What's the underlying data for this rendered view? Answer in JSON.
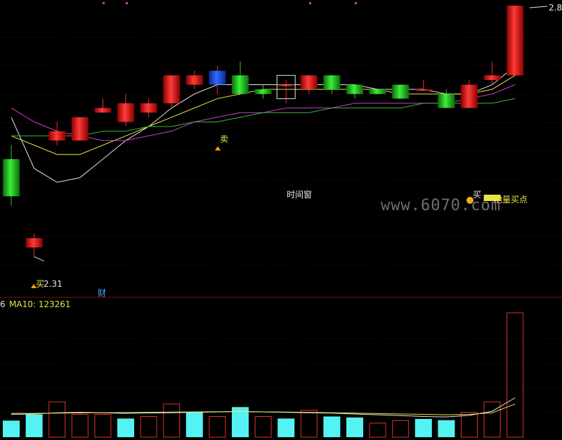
{
  "watermark": "www.6070.com",
  "labels": {
    "sell": "卖",
    "buy_left": "买",
    "low_price": "2.31",
    "high_price": "2.8",
    "cai": "财",
    "time_window": "时间窗",
    "buy_right": "买",
    "bottom_buy": "地量买点",
    "vol_prefix": "6",
    "ma10_label": "MA10: 123261"
  },
  "colors": {
    "up": "#ff2a2a",
    "down": "#22cc22",
    "ma_white": "#e6e6e6",
    "ma_yellow": "#e8e34a",
    "ma_magenta": "#d23ad2",
    "ma_green": "#37b837",
    "vol_up_outline": "#e03030",
    "vol_down_fill": "#54f2f2",
    "sell_candle": "#1a4fd6",
    "grid": "#4a0a0a"
  },
  "chart_data": [
    {
      "type": "candlestick",
      "title": "",
      "ylim": [
        2.25,
        2.85
      ],
      "candles": [
        {
          "o": 2.52,
          "c": 2.44,
          "h": 2.55,
          "l": 2.42
        },
        {
          "o": 2.33,
          "c": 2.35,
          "h": 2.36,
          "l": 2.31
        },
        {
          "o": 2.56,
          "c": 2.58,
          "h": 2.6,
          "l": 2.55
        },
        {
          "o": 2.56,
          "c": 2.61,
          "h": 2.61,
          "l": 2.56
        },
        {
          "o": 2.62,
          "c": 2.63,
          "h": 2.65,
          "l": 2.62
        },
        {
          "o": 2.6,
          "c": 2.64,
          "h": 2.66,
          "l": 2.59
        },
        {
          "o": 2.62,
          "c": 2.64,
          "h": 2.65,
          "l": 2.61
        },
        {
          "o": 2.64,
          "c": 2.7,
          "h": 2.7,
          "l": 2.63
        },
        {
          "o": 2.68,
          "c": 2.7,
          "h": 2.71,
          "l": 2.67
        },
        {
          "o": 2.68,
          "c": 2.71,
          "h": 2.72,
          "l": 2.66
        },
        {
          "o": 2.7,
          "c": 2.66,
          "h": 2.73,
          "l": 2.66
        },
        {
          "o": 2.67,
          "c": 2.66,
          "h": 2.68,
          "l": 2.65
        },
        {
          "o": 2.68,
          "c": 2.68,
          "h": 2.69,
          "l": 2.64
        },
        {
          "o": 2.67,
          "c": 2.7,
          "h": 2.7,
          "l": 2.66
        },
        {
          "o": 2.7,
          "c": 2.67,
          "h": 2.7,
          "l": 2.66
        },
        {
          "o": 2.68,
          "c": 2.66,
          "h": 2.68,
          "l": 2.65
        },
        {
          "o": 2.67,
          "c": 2.66,
          "h": 2.67,
          "l": 2.66
        },
        {
          "o": 2.68,
          "c": 2.65,
          "h": 2.68,
          "l": 2.65
        },
        {
          "o": 2.67,
          "c": 2.67,
          "h": 2.69,
          "l": 2.67
        },
        {
          "o": 2.66,
          "c": 2.63,
          "h": 2.67,
          "l": 2.63
        },
        {
          "o": 2.63,
          "c": 2.68,
          "h": 2.69,
          "l": 2.63
        },
        {
          "o": 2.69,
          "c": 2.7,
          "h": 2.73,
          "l": 2.68
        },
        {
          "o": 2.7,
          "c": 2.85,
          "h": 2.85,
          "l": 2.7
        }
      ],
      "ma_series": [
        {
          "values": [
            2.61,
            2.5,
            2.47,
            2.48,
            2.52,
            2.56,
            2.59,
            2.63,
            2.66,
            2.68,
            2.68,
            2.68,
            2.68,
            2.68,
            2.68,
            2.68,
            2.67,
            2.67,
            2.67,
            2.66,
            2.66,
            2.68,
            2.72
          ]
        },
        {
          "values": [
            2.57,
            2.55,
            2.53,
            2.53,
            2.55,
            2.57,
            2.59,
            2.61,
            2.63,
            2.65,
            2.66,
            2.67,
            2.67,
            2.67,
            2.67,
            2.67,
            2.67,
            2.66,
            2.66,
            2.66,
            2.66,
            2.67,
            2.7
          ]
        },
        {
          "values": [
            2.63,
            2.6,
            2.58,
            2.57,
            2.56,
            2.56,
            2.57,
            2.58,
            2.6,
            2.61,
            2.62,
            2.62,
            2.63,
            2.63,
            2.63,
            2.64,
            2.64,
            2.64,
            2.64,
            2.64,
            2.65,
            2.66,
            2.68
          ]
        },
        {
          "values": [
            2.57,
            2.57,
            2.57,
            2.57,
            2.58,
            2.58,
            2.59,
            2.59,
            2.6,
            2.6,
            2.61,
            2.62,
            2.62,
            2.62,
            2.63,
            2.63,
            2.63,
            2.63,
            2.64,
            2.64,
            2.64,
            2.64,
            2.65
          ]
        }
      ]
    },
    {
      "type": "bar",
      "title": "",
      "ylim": [
        0,
        600000
      ],
      "series": [
        {
          "values": [
            80000,
            110000,
            170000,
            110000,
            110000,
            90000,
            100000,
            160000,
            120000,
            100000,
            145000,
            100000,
            90000,
            130000,
            100000,
            95000,
            68000,
            80000,
            88000,
            82000,
            120000,
            170000,
            600000
          ]
        }
      ],
      "bar_up": [
        false,
        false,
        true,
        true,
        true,
        false,
        true,
        true,
        false,
        true,
        false,
        true,
        false,
        true,
        false,
        false,
        true,
        true,
        false,
        false,
        true,
        true,
        true
      ],
      "ma_series": [
        {
          "values": [
            110000,
            112000,
            118000,
            120000,
            118000,
            115000,
            117000,
            118000,
            120000,
            122000,
            124000,
            122000,
            120000,
            118000,
            116000,
            112000,
            108000,
            104000,
            100000,
            98000,
            105000,
            125000,
            190000
          ]
        },
        {
          "values": [
            115000,
            115000,
            116000,
            117000,
            118000,
            119000,
            120000,
            121000,
            122000,
            123000,
            123000,
            122000,
            121000,
            120000,
            118000,
            116000,
            114000,
            112000,
            110000,
            108000,
            110000,
            118000,
            160000
          ]
        }
      ]
    }
  ]
}
